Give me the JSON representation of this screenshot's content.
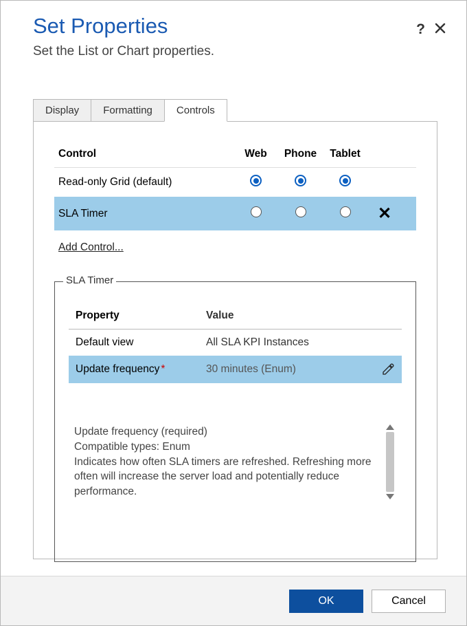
{
  "dialog": {
    "title": "Set Properties",
    "subtitle": "Set the List or Chart properties."
  },
  "tabs": {
    "display": "Display",
    "formatting": "Formatting",
    "controls": "Controls"
  },
  "controls_table": {
    "headers": {
      "control": "Control",
      "web": "Web",
      "phone": "Phone",
      "tablet": "Tablet"
    },
    "rows": [
      {
        "name": "Read-only Grid (default)"
      },
      {
        "name": "SLA Timer"
      }
    ],
    "add_label": "Add Control..."
  },
  "fieldset": {
    "legend": "SLA Timer",
    "headers": {
      "property": "Property",
      "value": "Value"
    },
    "rows": [
      {
        "property": "Default view",
        "value": "All SLA KPI Instances"
      },
      {
        "property": "Update frequency",
        "value": "30 minutes (Enum)"
      }
    ],
    "desc": {
      "line1": "Update frequency (required)",
      "line2": "Compatible types: Enum",
      "line3": "Indicates how often SLA timers are refreshed. Refreshing more often will increase the server load and potentially reduce performance."
    }
  },
  "footer": {
    "ok": "OK",
    "cancel": "Cancel"
  }
}
